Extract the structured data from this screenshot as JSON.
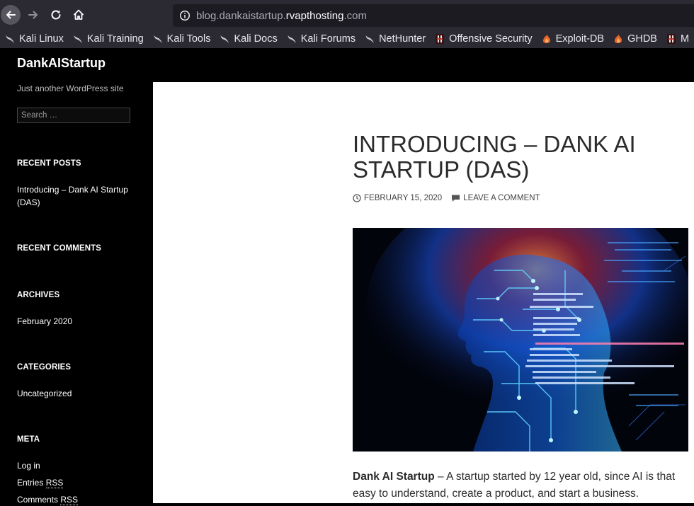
{
  "browser": {
    "url_prefix": "blog.dankaistartup.",
    "url_host": "rvapthosting",
    "url_suffix": ".com",
    "bookmarks": [
      {
        "label": "Kali Linux",
        "icon": "kali-dragon-icon"
      },
      {
        "label": "Kali Training",
        "icon": "kali-dragon-icon"
      },
      {
        "label": "Kali Tools",
        "icon": "kali-dragon-icon"
      },
      {
        "label": "Kali Docs",
        "icon": "kali-dragon-icon"
      },
      {
        "label": "Kali Forums",
        "icon": "kali-dragon-icon"
      },
      {
        "label": "NetHunter",
        "icon": "kali-dragon-icon"
      },
      {
        "label": "Offensive Security",
        "icon": "offsec-icon"
      },
      {
        "label": "Exploit-DB",
        "icon": "exploitdb-icon"
      },
      {
        "label": "GHDB",
        "icon": "exploitdb-icon"
      },
      {
        "label": "M",
        "icon": "offsec-icon"
      }
    ]
  },
  "site": {
    "title": "DankAIStartup",
    "description": "Just another WordPress site",
    "search_placeholder": "Search …"
  },
  "sidebar": {
    "recent_posts_title": "RECENT POSTS",
    "recent_post_line1": "Introducing – Dank AI Startup",
    "recent_post_line2": "(DAS)",
    "recent_comments_title": "RECENT COMMENTS",
    "archives_title": "ARCHIVES",
    "archive_item": "February 2020",
    "categories_title": "CATEGORIES",
    "category_item": "Uncategorized",
    "meta_title": "META",
    "meta_login": "Log in",
    "meta_entries_prefix": "Entries ",
    "meta_entries_rss": "RSS",
    "meta_comments_prefix": "Comments ",
    "meta_comments_rss": "RSS"
  },
  "post": {
    "title": "INTRODUCING – DANK AI STARTUP (DAS)",
    "date": "FEBRUARY 15, 2020",
    "comment_link": "LEAVE A COMMENT",
    "lead_bold": "Dank AI Startup",
    "lead_text": " – A startup started by 12 year old, since AI is that easy to understand, create a product, and start a business."
  },
  "colors": {
    "chrome_bg": "#2b2a33",
    "sidebar_bg": "#000000",
    "content_bg": "#ffffff",
    "accent_blue": "#1e90ff"
  }
}
